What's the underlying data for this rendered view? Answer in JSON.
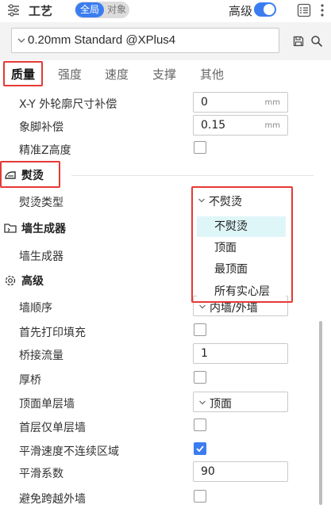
{
  "header": {
    "title": "工艺",
    "scope_global": "全局",
    "scope_object": "对象",
    "advanced_label": "高级",
    "advanced_on": true,
    "accent_color": "#3b7df0"
  },
  "preset": {
    "value": "0.20mm Standard @XPlus4"
  },
  "tabs": [
    {
      "label": "质量",
      "active": true
    },
    {
      "label": "强度",
      "active": false
    },
    {
      "label": "速度",
      "active": false
    },
    {
      "label": "支撑",
      "active": false
    },
    {
      "label": "其他",
      "active": false
    }
  ],
  "quality_rows": [
    {
      "label": "X-Y 外轮廓尺寸补偿",
      "value": "0",
      "unit": "mm"
    },
    {
      "label": "象脚补偿",
      "value": "0.15",
      "unit": "mm"
    },
    {
      "label": "精准Z高度",
      "checked": false
    }
  ],
  "ironing": {
    "title": "熨烫",
    "type_label": "熨烫类型",
    "type_value": "不熨烫",
    "options": [
      "不熨烫",
      "顶面",
      "最顶面",
      "所有实心层"
    ],
    "hovered_option": "不熨烫"
  },
  "wall_generator": {
    "title": "墙生成器",
    "row_label": "墙生成器"
  },
  "advanced": {
    "title": "高级",
    "wall_order_label": "墙顺序",
    "wall_order_value": "内墙/外墙",
    "first_infill_label": "首先打印填充",
    "first_infill_checked": false,
    "bridge_flow_label": "桥接流量",
    "bridge_flow_value": "1",
    "thick_bridge_label": "厚桥",
    "thick_bridge_checked": false,
    "top_wall_label": "顶面单层墙",
    "top_wall_value": "顶面",
    "first_layer_wall_label": "首层仅单层墙",
    "first_layer_wall_checked": false,
    "smooth_speed_label": "平滑速度不连续区域",
    "smooth_speed_checked": true,
    "smooth_coef_label": "平滑系数",
    "smooth_coef_value": "90",
    "avoid_crossing_label": "避免跨越外墙",
    "avoid_crossing_checked": false
  }
}
